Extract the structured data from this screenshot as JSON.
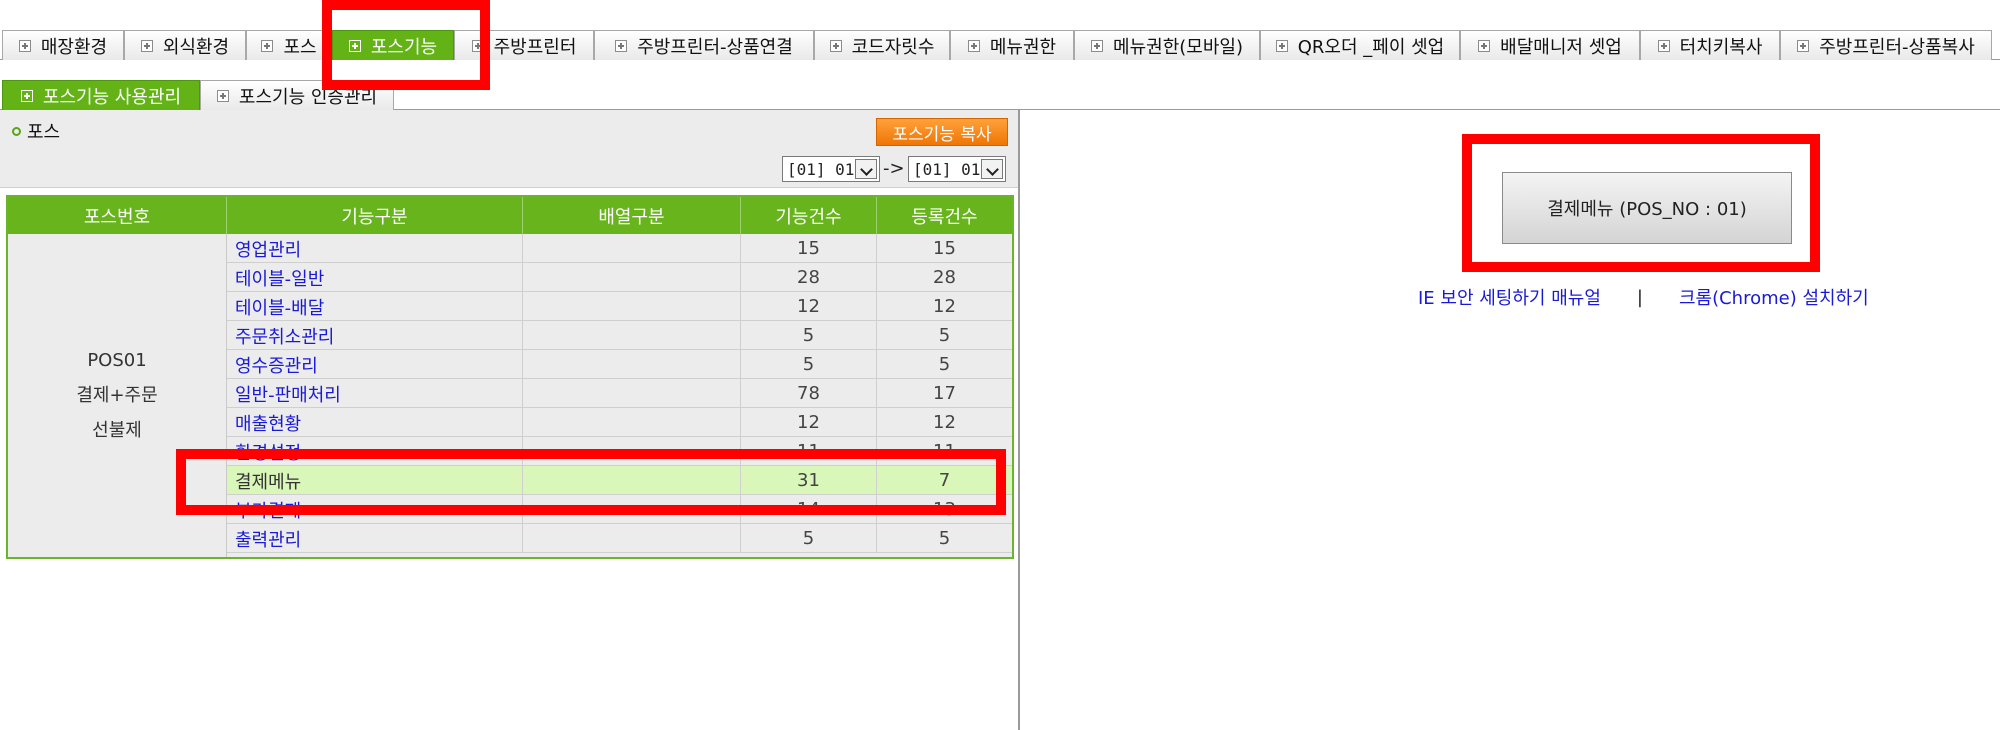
{
  "top_tabs": [
    {
      "label": "매장환경",
      "active": false
    },
    {
      "label": "외식환경",
      "active": false
    },
    {
      "label": "포스",
      "active": false
    },
    {
      "label": "포스기능",
      "active": true
    },
    {
      "label": "주방프린터",
      "active": false
    },
    {
      "label": "주방프린터-상품연결",
      "active": false
    },
    {
      "label": "코드자릿수",
      "active": false
    },
    {
      "label": "메뉴권한",
      "active": false
    },
    {
      "label": "메뉴권한(모바일)",
      "active": false
    },
    {
      "label": "QR오더 _페이 셋업",
      "active": false
    },
    {
      "label": "배달매니저 셋업",
      "active": false
    },
    {
      "label": "터치키복사",
      "active": false
    },
    {
      "label": "주방프린터-상품복사",
      "active": false
    }
  ],
  "sub_tabs": [
    {
      "label": "포스기능 사용관리",
      "active": true
    },
    {
      "label": "포스기능 인증관리",
      "active": false
    }
  ],
  "left": {
    "section_label": "포스",
    "copy_button": "포스기능 복사",
    "from_select": "[01] 01",
    "arrow": "->",
    "to_select": "[01] 01"
  },
  "table": {
    "headers": [
      "포스번호",
      "기능구분",
      "배열구분",
      "기능건수",
      "등록건수"
    ],
    "pos_cell": [
      "POS01",
      "결제+주문",
      "선불제"
    ],
    "rows": [
      {
        "func": "영업관리",
        "arr": "",
        "count": "15",
        "registered": "15"
      },
      {
        "func": "테이블-일반",
        "arr": "",
        "count": "28",
        "registered": "28"
      },
      {
        "func": "테이블-배달",
        "arr": "",
        "count": "12",
        "registered": "12"
      },
      {
        "func": "주문취소관리",
        "arr": "",
        "count": "5",
        "registered": "5"
      },
      {
        "func": "영수증관리",
        "arr": "",
        "count": "5",
        "registered": "5"
      },
      {
        "func": "일반-판매처리",
        "arr": "",
        "count": "78",
        "registered": "17"
      },
      {
        "func": "매출현황",
        "arr": "",
        "count": "12",
        "registered": "12"
      },
      {
        "func": "환경설정",
        "arr": "",
        "count": "11",
        "registered": "11"
      },
      {
        "func": "결제메뉴",
        "arr": "",
        "count": "31",
        "registered": "7",
        "highlight": true
      },
      {
        "func": "부가결제",
        "arr": "",
        "count": "14",
        "registered": "13"
      },
      {
        "func": "출력관리",
        "arr": "",
        "count": "5",
        "registered": "5"
      }
    ]
  },
  "right": {
    "payment_button": "결제메뉴 (POS_NO : 01)",
    "link_ie": "IE 보안 세팅하기 매뉴얼",
    "separator": "|",
    "link_chrome": "크롬(Chrome) 설치하기"
  },
  "colors": {
    "accent_green": "#63b317",
    "copy_orange": "#f48a1c",
    "link_blue": "#1a1ad6",
    "annotation_red": "#ff0000"
  }
}
